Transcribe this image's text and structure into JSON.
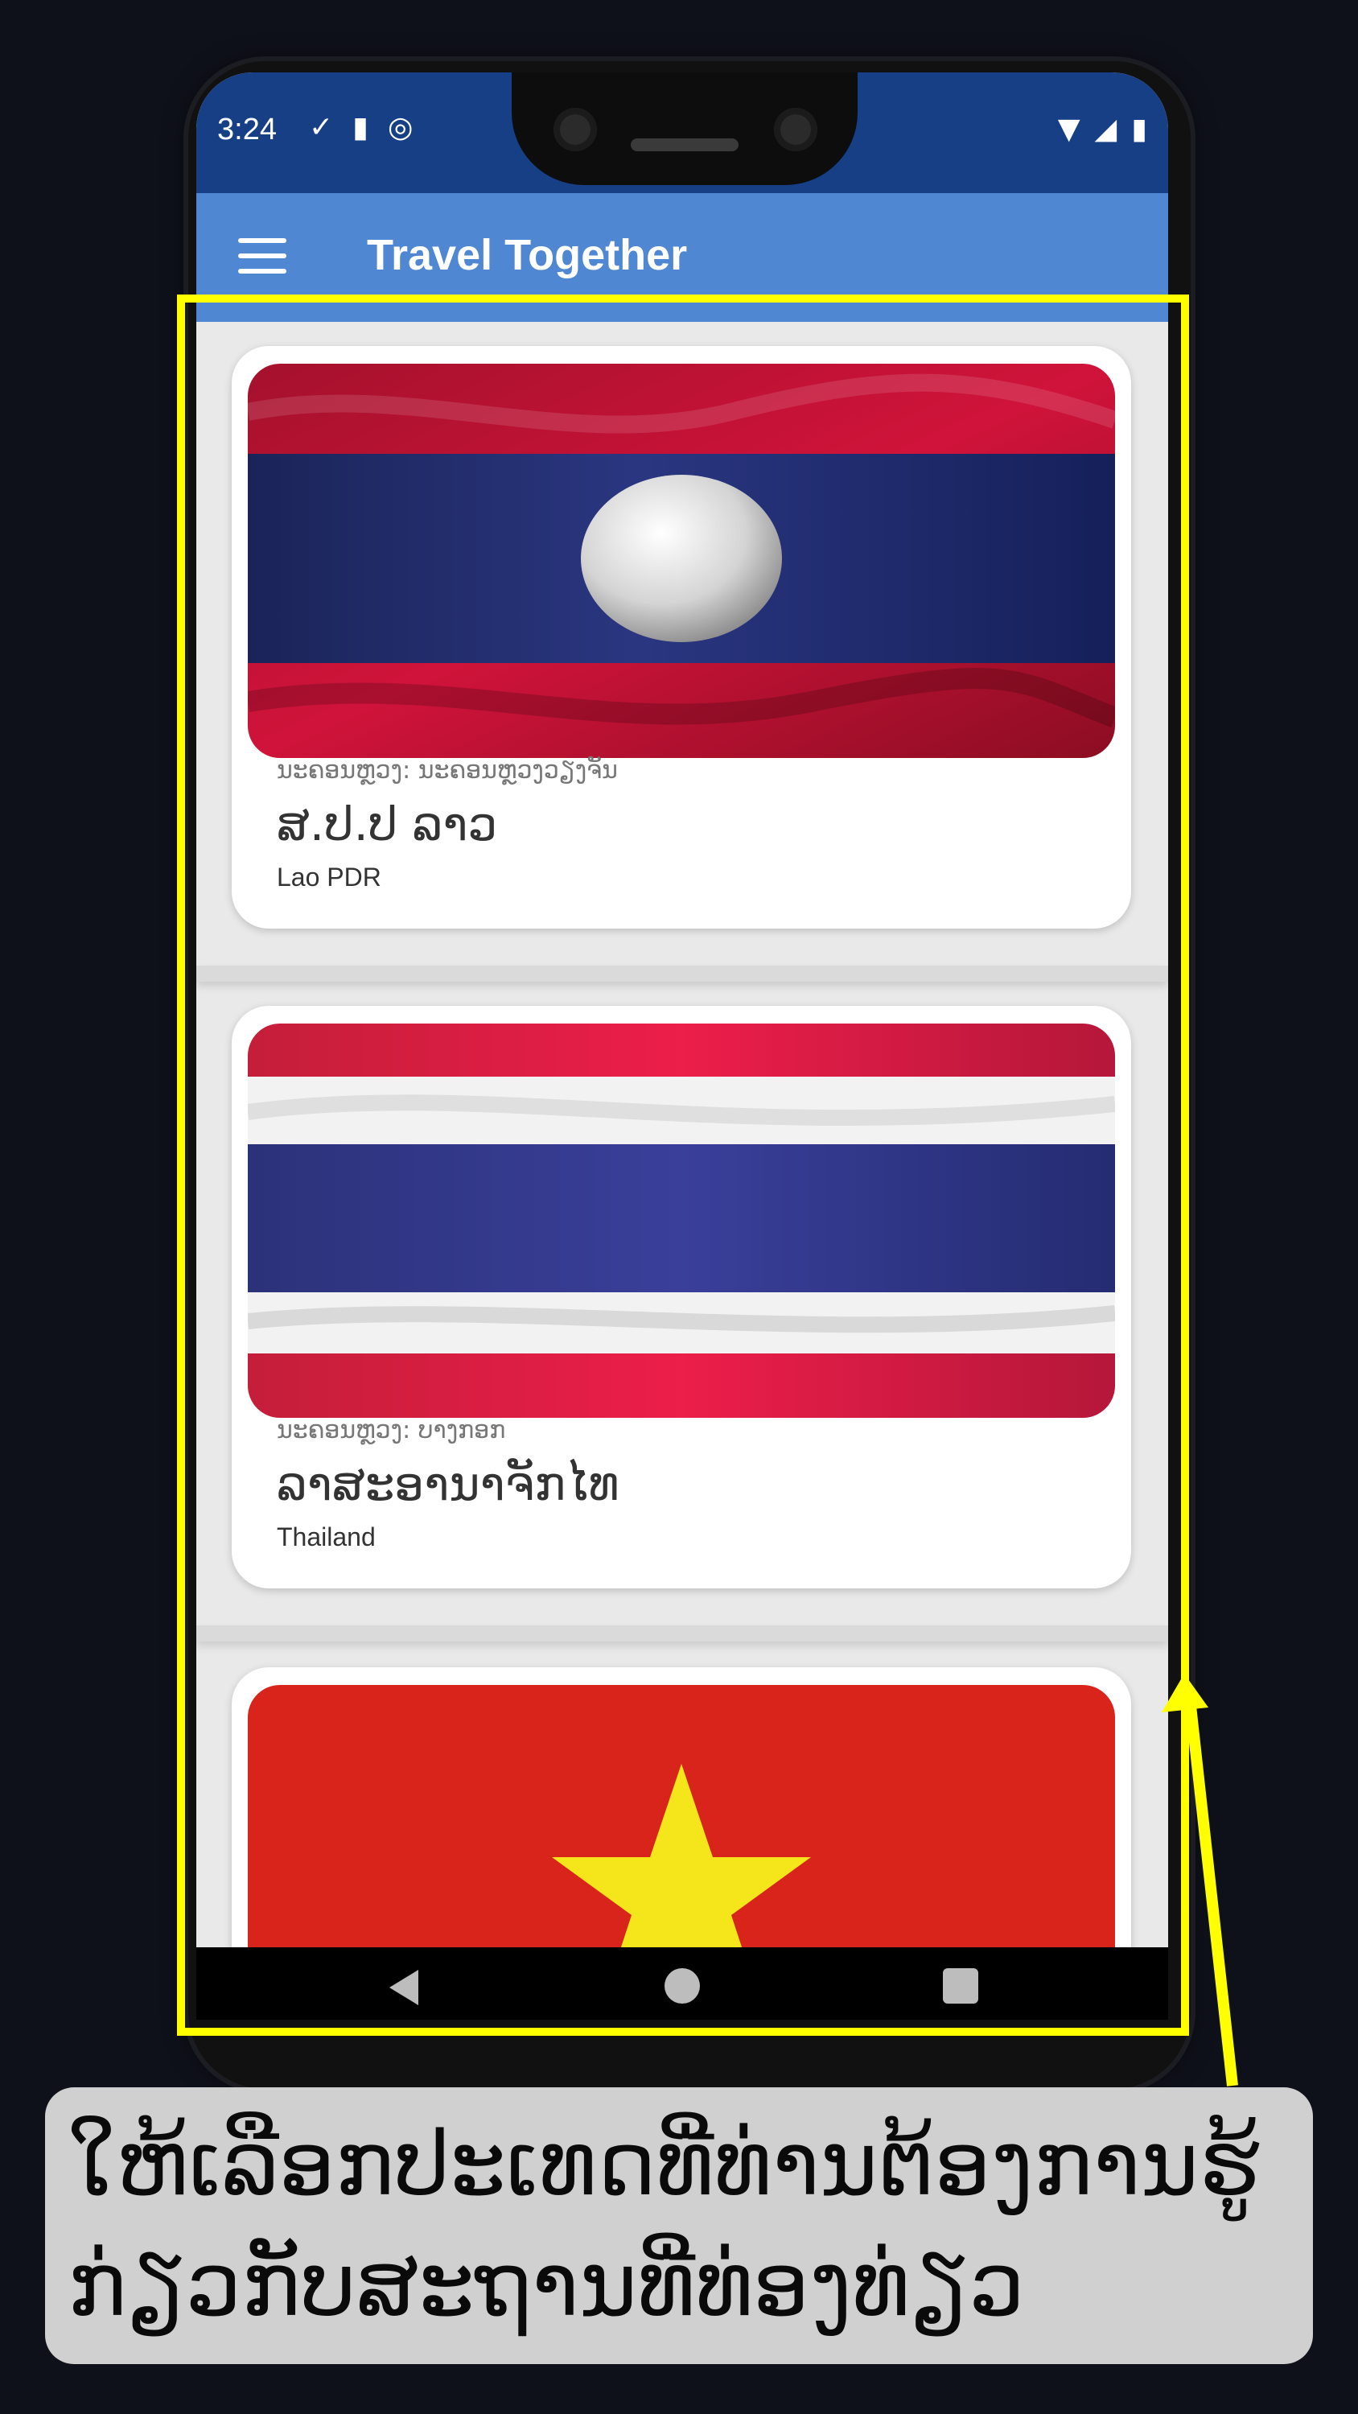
{
  "status_bar": {
    "time": "3:24",
    "left_icons": [
      "check-download-icon",
      "sd-card-icon",
      "sync-icon"
    ],
    "right_icons": [
      "wifi-icon",
      "signal-icon",
      "battery-icon"
    ]
  },
  "app_bar": {
    "title": "Travel Together",
    "menu_icon": "hamburger-menu-icon",
    "color": "#4f87d3"
  },
  "countries": [
    {
      "capital_label": "ນະຄອນຫຼວງ: ນະຄອນຫຼວງວຽງຈັນ",
      "name_lao": "ສ.ປ.ປ ລາວ",
      "name_en": "Lao PDR",
      "flag": "lao-flag"
    },
    {
      "capital_label": "ນະຄອນຫຼວງ: ບາງກອກ",
      "name_lao": "ລາສະອານາຈັກໄທ",
      "name_en": "Thailand",
      "flag": "thailand-flag"
    },
    {
      "flag": "vietnam-flag"
    }
  ],
  "nav_bar": {
    "icons": [
      "back-icon",
      "home-icon",
      "recents-icon"
    ]
  },
  "annotation": {
    "highlight_color": "#ffff00",
    "caption_lines": [
      "ໃຫ້ເລືອກປະເທດທີ່ທ່ານຕ້ອງການຮູ້",
      "ກ່ຽວກັບສະຖານທີ່ທ່ອງທ່ຽວ"
    ]
  }
}
